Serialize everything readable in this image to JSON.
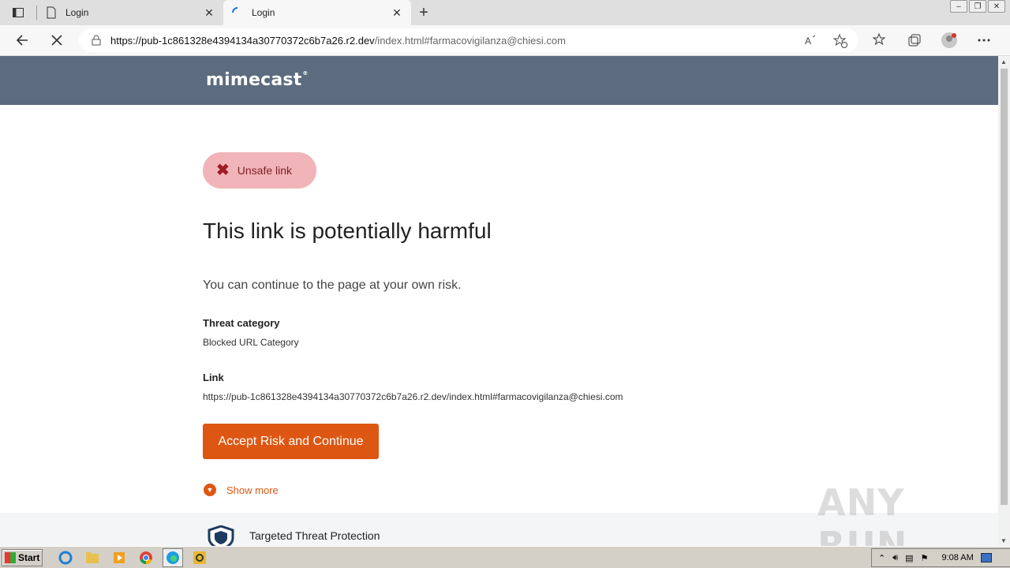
{
  "browser": {
    "tabs": [
      {
        "label": "Login",
        "close": "✕"
      },
      {
        "label": "Login",
        "close": "✕"
      }
    ],
    "new_tab": "+",
    "url_host": "https://pub-1c861328e4394134a30770372c6b7a26.r2.dev",
    "url_path": "/index.html#farmacovigilanza@chiesi.com"
  },
  "page": {
    "logo": "mimecast",
    "badge": "Unsafe link",
    "title": "This link is potentially harmful",
    "description": "You can continue to the page at your own risk.",
    "threat_category_label": "Threat category",
    "threat_category_value": "Blocked URL Category",
    "link_label": "Link",
    "link_value": "https://pub-1c861328e4394134a30770372c6b7a26.r2.dev/index.html#farmacovigilanza@chiesi.com",
    "accept_button": "Accept Risk and Continue",
    "show_more": "Show more",
    "footer_text": "Targeted Threat Protection"
  },
  "watermark": "ANY RUN",
  "taskbar": {
    "start": "Start",
    "clock": "9:08 AM"
  },
  "colors": {
    "header": "#5c6b7e",
    "badge_bg": "#f1b4b8",
    "accent": "#dd5713"
  }
}
